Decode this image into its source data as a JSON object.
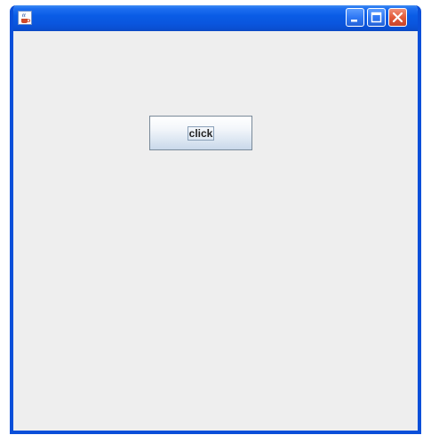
{
  "window": {
    "title": "",
    "icon": "java-cup-icon",
    "controls": {
      "minimize": "minimize-icon",
      "maximize": "maximize-icon",
      "close": "close-icon"
    },
    "colors": {
      "frame": "#0a4fd9",
      "client_background": "#eeeeee",
      "close_button": "#e35b3a"
    }
  },
  "content": {
    "button_label": "click"
  }
}
